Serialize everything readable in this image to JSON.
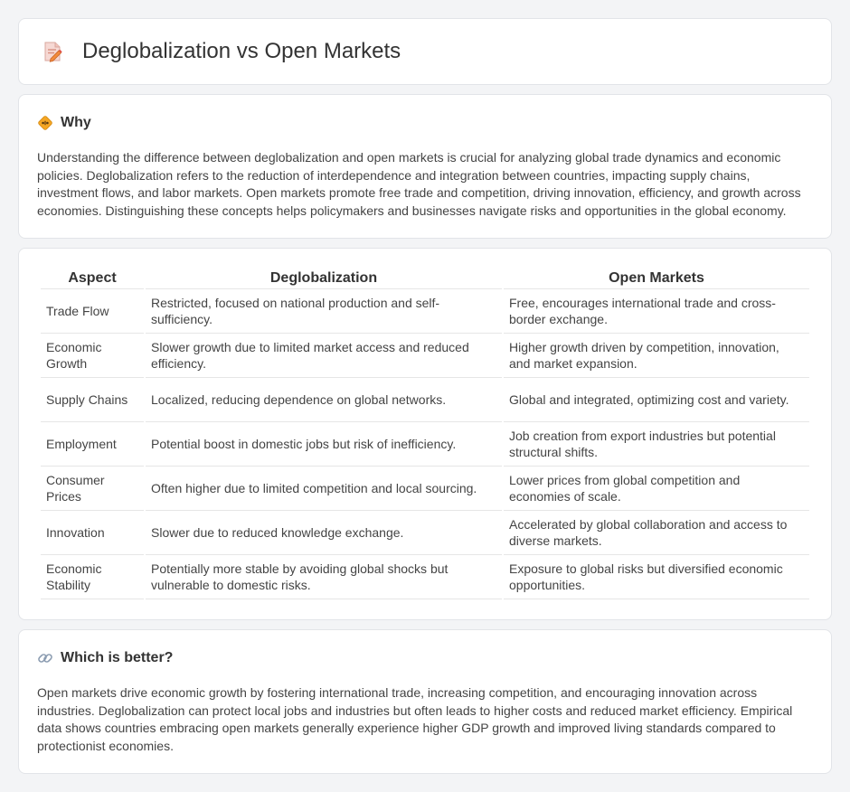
{
  "header": {
    "title": "Deglobalization vs Open Markets",
    "icon": "document-pen-icon"
  },
  "why": {
    "title": "Why",
    "icon": "diamond-sign-icon",
    "text": "Understanding the difference between deglobalization and open markets is crucial for analyzing global trade dynamics and economic policies. Deglobalization refers to the reduction of interdependence and integration between countries, impacting supply chains, investment flows, and labor markets. Open markets promote free trade and competition, driving innovation, efficiency, and growth across economies. Distinguishing these concepts helps policymakers and businesses navigate risks and opportunities in the global economy."
  },
  "comparison": {
    "headers": [
      "Aspect",
      "Deglobalization",
      "Open Markets"
    ],
    "rows": [
      {
        "aspect": "Trade Flow",
        "deglobalization": "Restricted, focused on national production and self-sufficiency.",
        "open_markets": "Free, encourages international trade and cross-border exchange."
      },
      {
        "aspect": "Economic Growth",
        "deglobalization": "Slower growth due to limited market access and reduced efficiency.",
        "open_markets": "Higher growth driven by competition, innovation, and market expansion."
      },
      {
        "aspect": "Supply Chains",
        "deglobalization": "Localized, reducing dependence on global networks.",
        "open_markets": "Global and integrated, optimizing cost and variety."
      },
      {
        "aspect": "Employment",
        "deglobalization": "Potential boost in domestic jobs but risk of inefficiency.",
        "open_markets": "Job creation from export industries but potential structural shifts."
      },
      {
        "aspect": "Consumer Prices",
        "deglobalization": "Often higher due to limited competition and local sourcing.",
        "open_markets": "Lower prices from global competition and economies of scale."
      },
      {
        "aspect": "Innovation",
        "deglobalization": "Slower due to reduced knowledge exchange.",
        "open_markets": "Accelerated by global collaboration and access to diverse markets."
      },
      {
        "aspect": "Economic Stability",
        "deglobalization": "Potentially more stable by avoiding global shocks but vulnerable to domestic risks.",
        "open_markets": "Exposure to global risks but diversified economic opportunities."
      }
    ]
  },
  "better": {
    "title": "Which is better?",
    "icon": "link-icon",
    "text": "Open markets drive economic growth by fostering international trade, increasing competition, and encouraging innovation across industries. Deglobalization can protect local jobs and industries but often leads to higher costs and reduced market efficiency. Empirical data shows countries embracing open markets generally experience higher GDP growth and improved living standards compared to protectionist economies."
  }
}
